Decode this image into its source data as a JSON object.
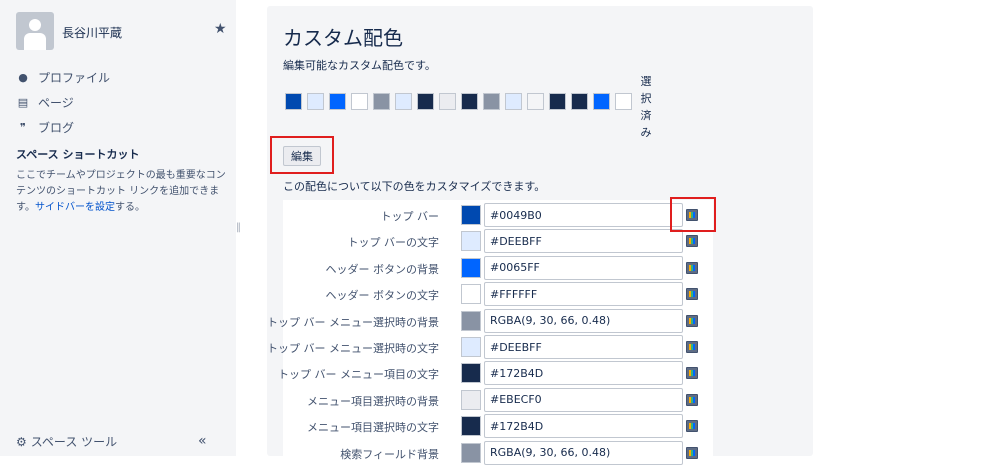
{
  "sidebar": {
    "user_name": "長谷川平蔵",
    "nav": [
      {
        "label": "プロファイル",
        "icon": "person-icon",
        "glyph": "●"
      },
      {
        "label": "ページ",
        "icon": "page-icon",
        "glyph": "▤"
      },
      {
        "label": "ブログ",
        "icon": "quote-icon",
        "glyph": "❞"
      }
    ],
    "shortcut_title": "スペース ショートカット",
    "shortcut_text_before": "ここでチームやプロジェクトの最も重要なコンテンツのショートカット リンクを追加できます。",
    "shortcut_link": "サイドバーを設定",
    "shortcut_text_after": "する。",
    "space_tools": "スペース ツール",
    "collapse_glyph": "«"
  },
  "main": {
    "title": "カスタム配色",
    "description": "編集可能なカスタム配色です。",
    "selected_label": "選択済み",
    "edit_button": "編集",
    "customize_note": "この配色について以下の色をカスタマイズできます。",
    "swatches": [
      "#0049B0",
      "#DEEBFF",
      "#0065FF",
      "#FFFFFF",
      "#8993A4",
      "#DEEBFF",
      "#172B4D",
      "#EBECF0",
      "#172B4D",
      "#8993A4",
      "#DEEBFF",
      "#F4F5F7",
      "#172B4D",
      "#172B4D",
      "#0065FF",
      "#FFFFFF"
    ],
    "rows": [
      {
        "label": "トップ バー",
        "value": "#0049B0",
        "color": "#0049B0"
      },
      {
        "label": "トップ バーの文字",
        "value": "#DEEBFF",
        "color": "#DEEBFF"
      },
      {
        "label": "ヘッダー ボタンの背景",
        "value": "#0065FF",
        "color": "#0065FF"
      },
      {
        "label": "ヘッダー ボタンの文字",
        "value": "#FFFFFF",
        "color": "#FFFFFF"
      },
      {
        "label": "トップ バー メニュー選択時の背景",
        "value": "RGBA(9, 30, 66, 0.48)",
        "color": "#8993A4"
      },
      {
        "label": "トップ バー メニュー選択時の文字",
        "value": "#DEEBFF",
        "color": "#DEEBFF"
      },
      {
        "label": "トップ バー メニュー項目の文字",
        "value": "#172B4D",
        "color": "#172B4D"
      },
      {
        "label": "メニュー項目選択時の背景",
        "value": "#EBECF0",
        "color": "#EBECF0"
      },
      {
        "label": "メニュー項目選択時の文字",
        "value": "#172B4D",
        "color": "#172B4D"
      },
      {
        "label": "検索フィールド背景",
        "value": "RGBA(9, 30, 66, 0.48)",
        "color": "#8993A4"
      }
    ]
  },
  "colors": {
    "accent": "#0052CC",
    "highlight": "#E01E1E",
    "panel_bg": "#F4F5F7"
  }
}
